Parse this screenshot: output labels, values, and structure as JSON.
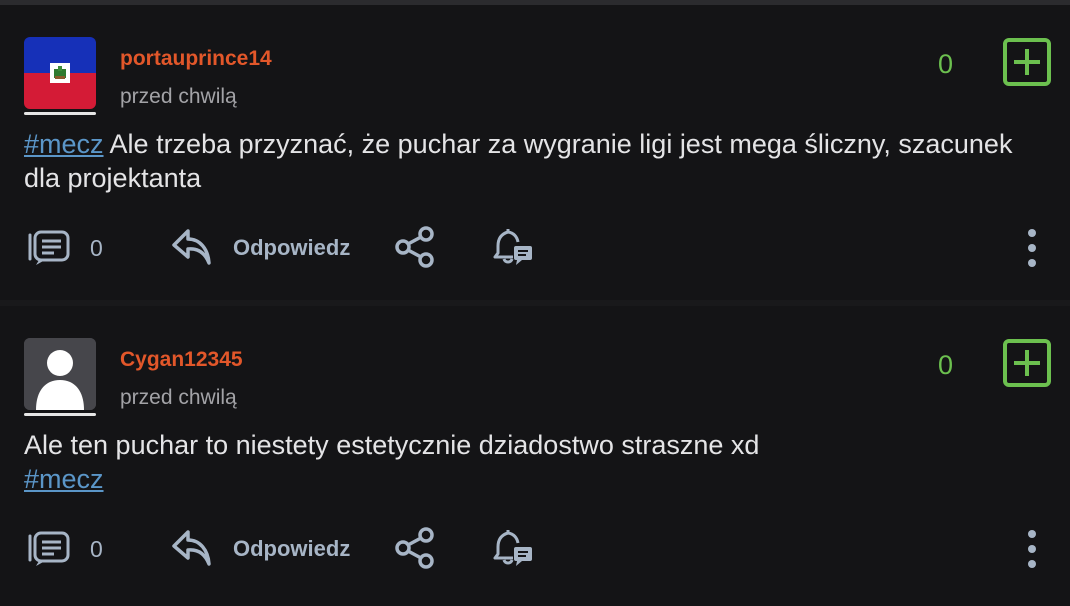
{
  "posts": [
    {
      "username": "portauprince14",
      "timestamp": "przed chwilą",
      "score": "0",
      "hashtag": "#mecz",
      "text": " Ale trzeba przyznać, że puchar za wygranie ligi jest mega śliczny, szacunek dla projektanta",
      "comment_count": "0",
      "reply_label": "Odpowiedz",
      "avatar": "flag-haiti"
    },
    {
      "username": "Cygan12345",
      "timestamp": "przed chwilą",
      "score": "0",
      "text": "Ale ten puchar to niestety estetycznie dziadostwo straszne xd",
      "hashtag": "#mecz",
      "comment_count": "0",
      "reply_label": "Odpowiedz",
      "avatar": "default-user-avatar"
    }
  ],
  "colors": {
    "background": "#141416",
    "username": "#e2572a",
    "score_green": "#6cc04f",
    "hashtag": "#5b96c8",
    "icon": "#a7b5c6"
  },
  "icons": [
    "comments-icon",
    "reply-icon",
    "share-icon",
    "notification-bell-icon",
    "more-vertical-icon",
    "plus-box-icon"
  ]
}
